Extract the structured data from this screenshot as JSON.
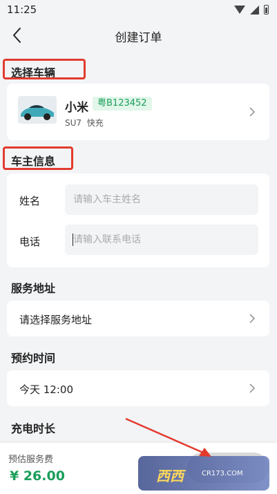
{
  "status_bar": {
    "time": "11:25"
  },
  "nav": {
    "title": "创建订单"
  },
  "vehicle_section": {
    "title": "选择车辆",
    "name": "小米",
    "plate": "粤B123452",
    "model": "SU7",
    "charge_type": "快充"
  },
  "owner_section": {
    "title": "车主信息",
    "name_label": "姓名",
    "name_placeholder": "请输入车主姓名",
    "phone_label": "电话",
    "phone_placeholder": "请输入联系电话"
  },
  "address_section": {
    "title": "服务地址",
    "value": "请选择服务地址"
  },
  "time_section": {
    "title": "预约时间",
    "value": "今天 12:00"
  },
  "duration_section": {
    "title": "充电时长"
  },
  "bottom": {
    "fee_label": "预估服务费",
    "fee_value": "¥ 26.00"
  },
  "watermark": {
    "text": "西西",
    "sub": "CR173.COM"
  },
  "colors": {
    "accent_green": "#1a9e5a",
    "annotation_red": "#e23b2e"
  }
}
